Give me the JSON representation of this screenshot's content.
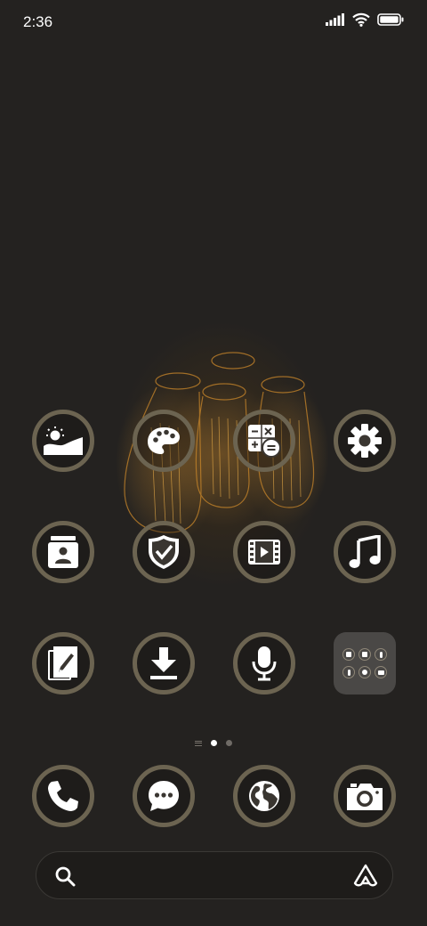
{
  "status_bar": {
    "time": "2:36",
    "icons": [
      "signal-icon",
      "wifi-icon",
      "battery-icon"
    ]
  },
  "home_grid": [
    {
      "name": "gallery-icon"
    },
    {
      "name": "themes-icon"
    },
    {
      "name": "calculator-icon"
    },
    {
      "name": "settings-icon"
    },
    {
      "name": "contacts-icon"
    },
    {
      "name": "security-icon"
    },
    {
      "name": "video-icon"
    },
    {
      "name": "music-icon"
    },
    {
      "name": "notes-icon"
    },
    {
      "name": "downloads-icon"
    },
    {
      "name": "recorder-icon"
    },
    {
      "name": "app-folder"
    }
  ],
  "folder_items": [
    "scanner-icon",
    "camera-video-icon",
    "mic-icon",
    "mic-small-icon",
    "globe-icon",
    "camera-icon"
  ],
  "page_indicator": {
    "pages": 2,
    "active": 1
  },
  "dock": [
    {
      "name": "phone-icon"
    },
    {
      "name": "messages-icon"
    },
    {
      "name": "browser-icon"
    },
    {
      "name": "camera-icon"
    }
  ],
  "search_bar": {
    "left_icon": "search-icon",
    "right_icon": "assistant-logo-icon"
  },
  "colors": {
    "background": "#242220",
    "ring": "#6c6451",
    "folder": "#4a4846"
  }
}
